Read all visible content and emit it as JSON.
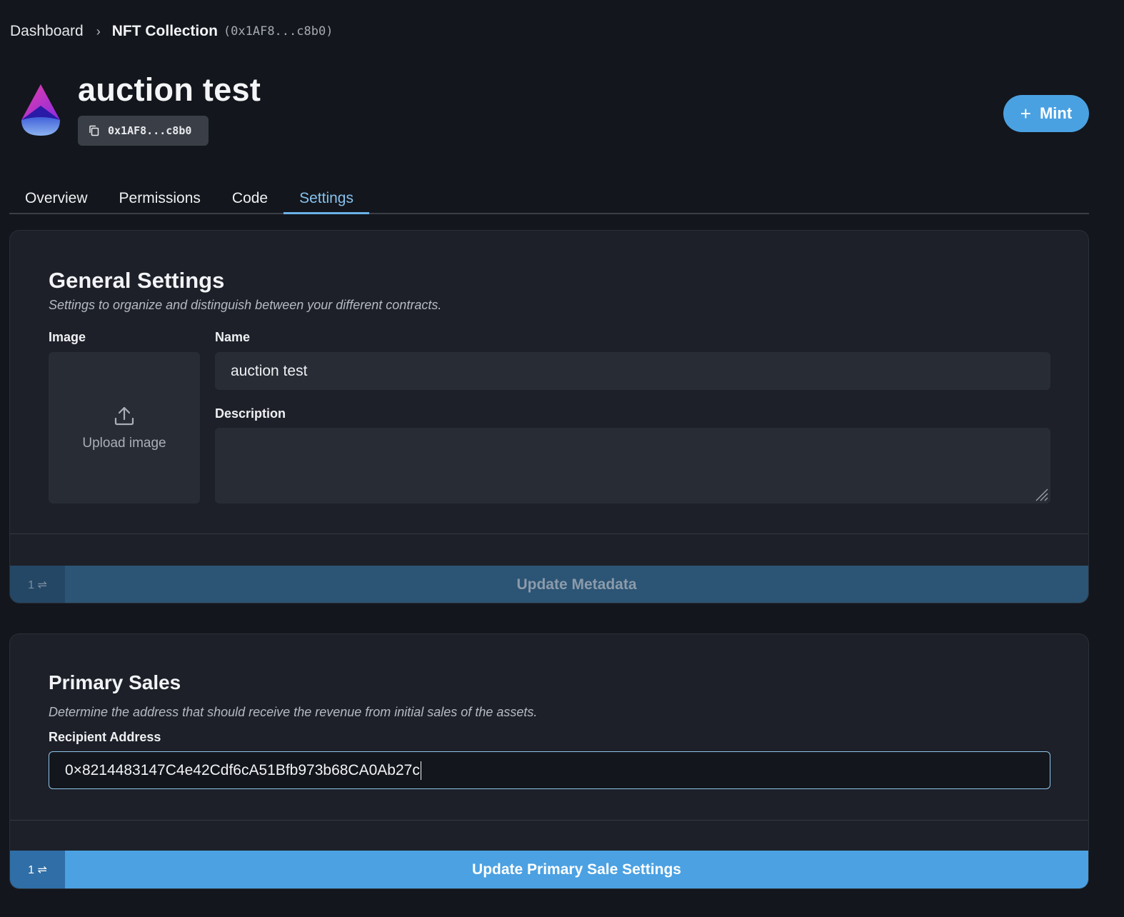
{
  "breadcrumb": {
    "root": "Dashboard",
    "separator": "›",
    "current": "NFT Collection",
    "address": "(0x1AF8...c8b0)"
  },
  "header": {
    "title": "auction test",
    "address_chip": "0x1AF8...c8b0",
    "mint_label": "Mint",
    "mint_icon": "plus-icon"
  },
  "tabs": [
    {
      "label": "Overview",
      "active": false
    },
    {
      "label": "Permissions",
      "active": false
    },
    {
      "label": "Code",
      "active": false
    },
    {
      "label": "Settings",
      "active": true
    }
  ],
  "general_settings": {
    "title": "General Settings",
    "description": "Settings to organize and distinguish between your different contracts.",
    "image_label": "Image",
    "upload_label": "Upload image",
    "name_label": "Name",
    "name_value": "auction test",
    "description_label": "Description",
    "description_value": "",
    "tx_count": "1 ⇌",
    "submit_label": "Update Metadata"
  },
  "primary_sales": {
    "title": "Primary Sales",
    "description": "Determine the address that should receive the revenue from initial sales of the assets.",
    "recipient_label": "Recipient Address",
    "recipient_value": "0×8214483147C4e42Cdf6cA51Bfb973b68CA0Ab27c",
    "tx_count": "1 ⇌",
    "submit_label": "Update Primary Sale Settings"
  },
  "colors": {
    "background": "#13161c",
    "card": "#1d2028",
    "accent": "#4ba1e2",
    "tab_active": "#86c2ef"
  }
}
